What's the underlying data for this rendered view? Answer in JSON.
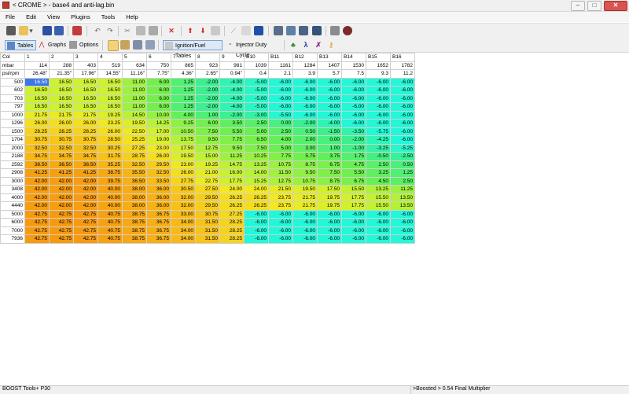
{
  "window": {
    "title": "< CROME > - base4 and anti-lag.bin",
    "min": "–",
    "max": "□",
    "close": "✕"
  },
  "menu": [
    "File",
    "Edit",
    "View",
    "Plugins",
    "Tools",
    "Help"
  ],
  "toolbar2": {
    "tables": "Tables",
    "graphs": "Graphs",
    "options": "Options",
    "ignition_fuel": "Ignition/Fuel Tables",
    "injector": "Injector Duty Cycle"
  },
  "grid": {
    "col_header": [
      "Col",
      "1",
      "2",
      "3",
      "4",
      "5",
      "6",
      "7",
      "8",
      "9",
      "B10",
      "B11",
      "B12",
      "B13",
      "B14",
      "B15",
      "B16"
    ],
    "mbar_row": [
      "mbar",
      "114",
      "288",
      "403",
      "519",
      "634",
      "750",
      "865",
      "923",
      "981",
      "1039",
      "1161",
      "1284",
      "1407",
      "1530",
      "1652",
      "1782"
    ],
    "psi_row": [
      "psi/rpm",
      "26.48\"",
      "21.35\"",
      "17.96\"",
      "14.55\"",
      "11.16\"",
      "7.75\"",
      "4.36\"",
      "2.65\"",
      "0.94\"",
      "0.4",
      "2.1",
      "3.9",
      "5.7",
      "7.5",
      "9.3",
      "11.2"
    ],
    "rows": [
      {
        "rpm": "500",
        "v": [
          "16.50",
          "16.50",
          "16.50",
          "16.50",
          "11.00",
          "6.00",
          "1.25",
          "-2.00",
          "-4.00",
          "-5.00",
          "-6.00",
          "-6.00",
          "-6.00",
          "-6.00",
          "-6.00",
          "-6.00"
        ]
      },
      {
        "rpm": "602",
        "v": [
          "16.50",
          "16.50",
          "16.50",
          "16.50",
          "11.00",
          "6.00",
          "1.25",
          "-2.00",
          "-4.00",
          "-5.00",
          "-6.00",
          "-6.00",
          "-6.00",
          "-6.00",
          "-6.00",
          "-6.00"
        ]
      },
      {
        "rpm": "703",
        "v": [
          "16.50",
          "16.50",
          "16.50",
          "16.50",
          "11.00",
          "6.00",
          "1.25",
          "-2.00",
          "-4.00",
          "-5.00",
          "-6.00",
          "-6.00",
          "-6.00",
          "-6.00",
          "-6.00",
          "-6.00"
        ]
      },
      {
        "rpm": "797",
        "v": [
          "16.50",
          "16.50",
          "16.50",
          "16.50",
          "11.00",
          "6.00",
          "1.25",
          "-2.00",
          "-4.00",
          "-5.00",
          "-6.00",
          "-6.00",
          "-6.00",
          "-6.00",
          "-6.00",
          "-6.00"
        ]
      },
      {
        "rpm": "1000",
        "v": [
          "21.75",
          "21.75",
          "21.75",
          "19.25",
          "14.50",
          "10.00",
          "4.00",
          "1.00",
          "-2.00",
          "-3.00",
          "-5.50",
          "-6.00",
          "-6.00",
          "-6.00",
          "-6.00",
          "-6.00"
        ]
      },
      {
        "rpm": "1296",
        "v": [
          "26.00",
          "26.00",
          "26.00",
          "23.25",
          "19.50",
          "14.25",
          "9.25",
          "6.00",
          "3.50",
          "2.50",
          "0.00",
          "-2.00",
          "-4.00",
          "-6.00",
          "-6.00",
          "-6.00"
        ]
      },
      {
        "rpm": "1500",
        "v": [
          "28.25",
          "28.25",
          "28.25",
          "26.00",
          "22.50",
          "17.00",
          "10.50",
          "7.50",
          "5.50",
          "5.00",
          "2.50",
          "0.50",
          "-1.50",
          "-3.50",
          "-5.75",
          "-6.00"
        ]
      },
      {
        "rpm": "1704",
        "v": [
          "30.75",
          "30.75",
          "30.75",
          "28.50",
          "25.25",
          "19.00",
          "13.75",
          "9.50",
          "7.75",
          "6.50",
          "4.00",
          "2.00",
          "0.00",
          "-2.00",
          "-4.25",
          "-6.00"
        ]
      },
      {
        "rpm": "2000",
        "v": [
          "32.50",
          "32.50",
          "32.50",
          "30.25",
          "27.25",
          "23.00",
          "17.50",
          "12.75",
          "9.50",
          "7.50",
          "5.00",
          "3.00",
          "1.00",
          "-1.00",
          "-3.25",
          "-5.25"
        ]
      },
      {
        "rpm": "2188",
        "v": [
          "34.75",
          "34.75",
          "34.75",
          "31.75",
          "28.75",
          "26.00",
          "19.50",
          "15.00",
          "11.25",
          "10.25",
          "7.75",
          "5.75",
          "3.75",
          "1.75",
          "-0.50",
          "-2.50"
        ]
      },
      {
        "rpm": "2592",
        "v": [
          "38.50",
          "38.50",
          "38.50",
          "35.25",
          "32.50",
          "29.50",
          "23.00",
          "19.25",
          "14.75",
          "13.25",
          "10.75",
          "8.75",
          "6.75",
          "4.75",
          "2.50",
          "0.50"
        ]
      },
      {
        "rpm": "2908",
        "v": [
          "41.25",
          "41.25",
          "41.25",
          "38.75",
          "35.50",
          "32.50",
          "26.00",
          "21.00",
          "16.00",
          "14.00",
          "11.50",
          "9.50",
          "7.50",
          "5.50",
          "3.25",
          "1.25"
        ]
      },
      {
        "rpm": "3000",
        "v": [
          "42.00",
          "42.00",
          "42.00",
          "39.75",
          "36.50",
          "33.50",
          "27.75",
          "22.75",
          "17.75",
          "15.25",
          "12.75",
          "10.75",
          "8.75",
          "6.75",
          "4.50",
          "2.50"
        ]
      },
      {
        "rpm": "3408",
        "v": [
          "42.00",
          "42.00",
          "42.00",
          "40.00",
          "38.00",
          "36.00",
          "30.50",
          "27.50",
          "24.00",
          "24.00",
          "21.50",
          "19.50",
          "17.50",
          "15.50",
          "13.25",
          "11.25"
        ]
      },
      {
        "rpm": "4000",
        "v": [
          "42.00",
          "42.00",
          "42.00",
          "40.00",
          "38.00",
          "36.00",
          "32.00",
          "29.50",
          "26.25",
          "26.25",
          "23.75",
          "21.75",
          "19.75",
          "17.75",
          "15.50",
          "13.50"
        ]
      },
      {
        "rpm": "4440",
        "v": [
          "42.00",
          "42.00",
          "42.00",
          "40.00",
          "38.00",
          "36.00",
          "32.00",
          "29.50",
          "26.25",
          "26.25",
          "23.75",
          "21.75",
          "19.75",
          "17.75",
          "15.50",
          "13.50"
        ]
      },
      {
        "rpm": "5000",
        "v": [
          "42.75",
          "42.75",
          "42.75",
          "40.75",
          "38.75",
          "36.75",
          "33.00",
          "30.75",
          "27.25",
          "-6.00",
          "-6.00",
          "-6.00",
          "-6.00",
          "-6.00",
          "-6.00",
          "-6.00"
        ]
      },
      {
        "rpm": "6000",
        "v": [
          "42.75",
          "42.75",
          "42.75",
          "40.75",
          "38.75",
          "36.75",
          "34.00",
          "31.50",
          "28.25",
          "-6.00",
          "-6.00",
          "-6.00",
          "-6.00",
          "-6.00",
          "-6.00",
          "-6.00"
        ]
      },
      {
        "rpm": "7000",
        "v": [
          "42.75",
          "42.75",
          "42.75",
          "40.75",
          "38.75",
          "36.75",
          "34.00",
          "31.50",
          "28.25",
          "-6.00",
          "-6.00",
          "-6.00",
          "-6.00",
          "-6.00",
          "-6.00",
          "-6.00"
        ]
      },
      {
        "rpm": "7936",
        "v": [
          "42.75",
          "42.75",
          "42.75",
          "40.75",
          "38.75",
          "36.75",
          "34.00",
          "31.50",
          "28.25",
          "-6.00",
          "-6.00",
          "-6.00",
          "-6.00",
          "-6.00",
          "-6.00",
          "-6.00"
        ]
      }
    ],
    "selected_cell": {
      "row": 0,
      "col": 0
    }
  },
  "status": {
    "left": "BOOST Tools+ P30",
    "right": ">Boosted > 0.54 Final Multiplier"
  }
}
